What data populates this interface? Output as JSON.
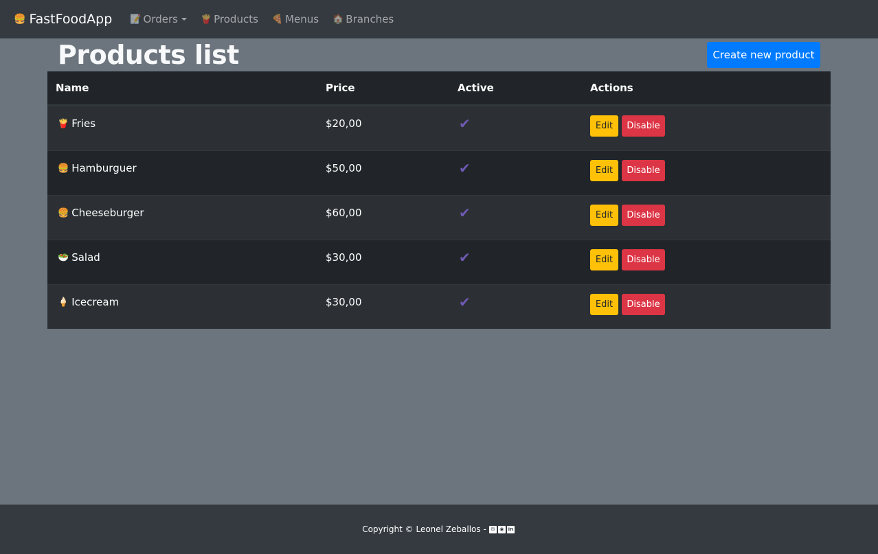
{
  "navbar": {
    "brand_emoji": "🍔",
    "brand": "FastFoodApp",
    "items": [
      {
        "emoji": "📝",
        "label": "Orders",
        "dropdown": true
      },
      {
        "emoji": "🍟",
        "label": "Products"
      },
      {
        "emoji": "🍕",
        "label": "Menus"
      },
      {
        "emoji": "🏠",
        "label": "Branches"
      }
    ]
  },
  "page": {
    "title": "Products list",
    "create_button": "Create new product"
  },
  "table": {
    "headers": [
      "Name",
      "Price",
      "Active",
      "Actions"
    ],
    "rows": [
      {
        "emoji": "🍟",
        "name": "Fries",
        "price": "$20,00",
        "active": "✔"
      },
      {
        "emoji": "🍔",
        "name": "Hamburguer",
        "price": "$50,00",
        "active": "✔"
      },
      {
        "emoji": "🍔",
        "name": "Cheeseburger",
        "price": "$60,00",
        "active": "✔"
      },
      {
        "emoji": "🥗",
        "name": "Salad",
        "price": "$30,00",
        "active": "✔"
      },
      {
        "emoji": "🍦",
        "name": "Icecream",
        "price": "$30,00",
        "active": "✔"
      }
    ],
    "edit_label": "Edit",
    "disable_label": "Disable"
  },
  "footer": {
    "copyright": "Copyright © Leonel Zeballos -",
    "icons": [
      "mail-icon",
      "github-icon",
      "linkedin-icon"
    ]
  },
  "colors": {
    "navbar_bg": "#343a40",
    "page_bg": "#6c757d",
    "primary": "#007bff",
    "warning": "#ffc107",
    "danger": "#dc3545",
    "check": "#6f5ab4"
  }
}
